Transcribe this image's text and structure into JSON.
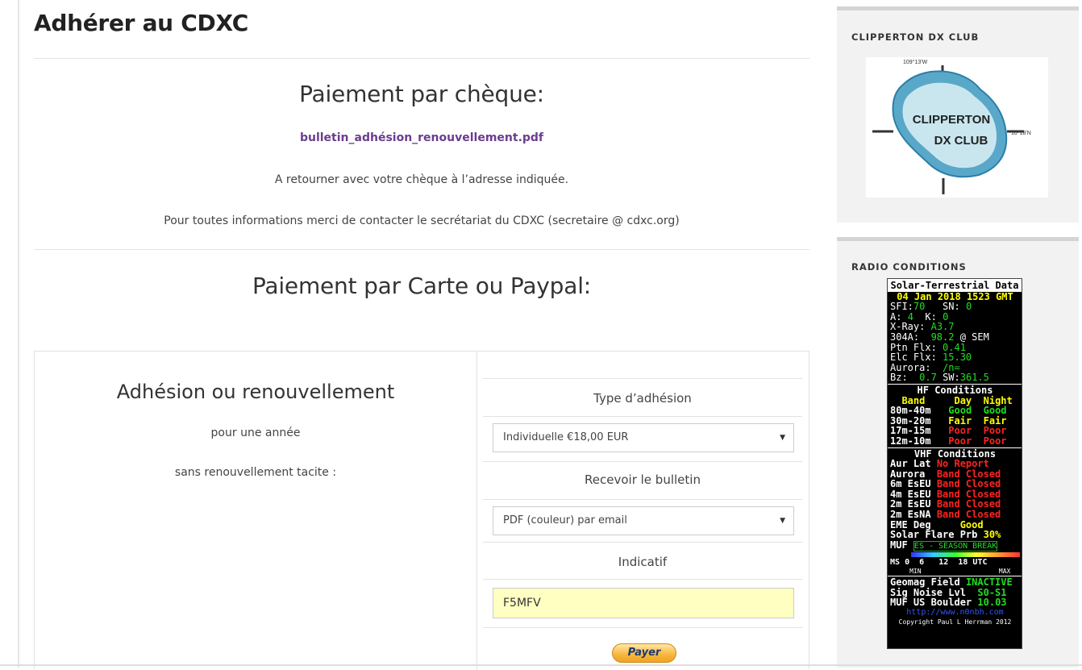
{
  "page": {
    "title": "Adhérer au CDXC"
  },
  "cheque": {
    "heading": "Paiement par chèque:",
    "pdf_link": "bulletin_adhésion_renouvellement.pdf",
    "return_text": "A retourner avec votre chèque à l’adresse indiquée.",
    "contact_text": "Pour toutes informations merci de contacter le secrétariat du CDXC (secretaire @ cdxc.org)"
  },
  "card": {
    "heading": "Paiement par Carte ou Paypal:"
  },
  "form": {
    "heading": "Adhésion ou renouvellement",
    "line1": "pour une année",
    "line2": "sans renouvellement tacite :",
    "type_label": "Type d’adhésion",
    "type_value": "Individuelle €18,00 EUR",
    "bulletin_label": "Recevoir le bulletin",
    "bulletin_value": "PDF (couleur) par email",
    "callsign_label": "Indicatif",
    "callsign_value": "F5MFV",
    "pay_button": "Payer"
  },
  "sidebar": {
    "club_widget_title": "CLIPPERTON DX CLUB",
    "logo": {
      "line1": "CLIPPERTON",
      "line2": "DX CLUB",
      "lon": "109°13'W",
      "lat": "10°18'N"
    },
    "radio_widget_title": "RADIO CONDITIONS"
  },
  "solar": {
    "title": "Solar-Terrestrial Data",
    "date": "04 Jan 2018 1523 GMT",
    "sfi_label": "SFI:",
    "sfi": "70",
    "sn_label": "SN:",
    "sn": "0",
    "a_label": "A:",
    "a": "4",
    "k_label": "K:",
    "k": "0",
    "xray_label": "X-Ray:",
    "xray": "A3.7",
    "f304_label": "304A:",
    "f304": "98.2",
    "f304_suffix": "@ SEM",
    "ptn_label": "Ptn Flx:",
    "ptn": "0.41",
    "elc_label": "Elc Flx:",
    "elc": "15.30",
    "aurora_label": "Aurora:",
    "aurora": "/n=",
    "bz_label": "Bz:",
    "bz": "0.7",
    "sw_label": "SW:",
    "sw": "361.5",
    "hf_title": "HF Conditions",
    "hf_head": [
      "Band",
      "Day",
      "Night"
    ],
    "hf_rows": [
      {
        "band": "80m-40m",
        "day": "Good",
        "night": "Good"
      },
      {
        "band": "30m-20m",
        "day": "Fair",
        "night": "Fair"
      },
      {
        "band": "17m-15m",
        "day": "Poor",
        "night": "Poor"
      },
      {
        "band": "12m-10m",
        "day": "Poor",
        "night": "Poor"
      }
    ],
    "vhf_title": "VHF Conditions",
    "vhf_rows": [
      {
        "name": "Aur Lat",
        "value": "No Report"
      },
      {
        "name": "Aurora",
        "value": "Band Closed"
      },
      {
        "name": "6m EsEU",
        "value": "Band Closed"
      },
      {
        "name": "4m EsEU",
        "value": "Band Closed"
      },
      {
        "name": "2m EsEU",
        "value": "Band Closed"
      },
      {
        "name": "2m EsNA",
        "value": "Band Closed"
      }
    ],
    "eme_label": "EME Deg",
    "eme": "Good",
    "flare_label": "Solar Flare Prb",
    "flare": "30%",
    "muf_label": "MUF",
    "muf": "ES - SEASON BREAK",
    "ms_label": "MS",
    "ms_scale": [
      "0",
      "6",
      "12",
      "18",
      "UTC"
    ],
    "ms_min": "MIN",
    "ms_max": "MAX",
    "geomag_label": "Geomag Field",
    "geomag": "INACTIVE",
    "noise_label": "Sig Noise Lvl",
    "noise": "S0-S1",
    "mufus_label": "MUF US Boulder",
    "mufus": "10.03",
    "url": "http://www.n0nbh.com",
    "copyright": "Copyright Paul L Herrman 2012"
  }
}
